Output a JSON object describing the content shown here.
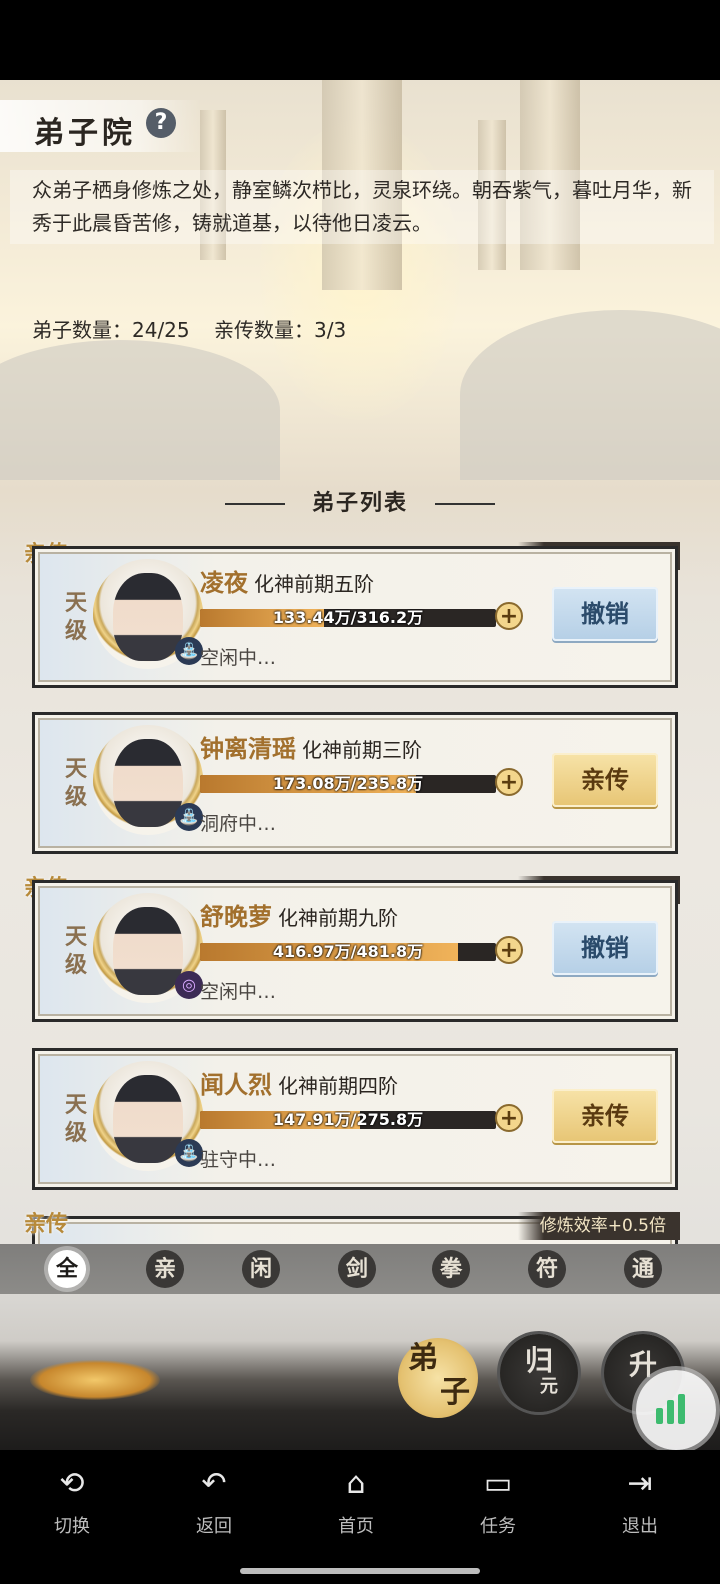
{
  "header": {
    "title": "弟子院",
    "help": "?"
  },
  "description": "众弟子栖身修炼之处，静室鳞次栉比，灵泉环绕。朝吞紫气，暮吐月华，新秀于此晨昏苦修，铸就道基，以待他日凌云。",
  "stats": {
    "disciple_count": "弟子数量：24/25",
    "inherit_count": "亲传数量：3/3"
  },
  "section_title": "弟子列表",
  "tags": {
    "inherit": "亲传",
    "efficiency": "修炼效率+0.5倍"
  },
  "disciples": [
    {
      "name": "凌夜",
      "realm": "化神前期五阶",
      "progress": "133.44万/316.2万",
      "progress_ratio": 0.42,
      "status": "空闲中…",
      "tier": "天级",
      "action": "撤销",
      "is_inherit": true
    },
    {
      "name": "钟离清瑶",
      "realm": "化神前期三阶",
      "progress": "173.08万/235.8万",
      "progress_ratio": 0.73,
      "status": "洞府中…",
      "tier": "天级",
      "action": "亲传",
      "is_inherit": false
    },
    {
      "name": "舒晚萝",
      "realm": "化神前期九阶",
      "progress": "416.97万/481.8万",
      "progress_ratio": 0.87,
      "status": "空闲中…",
      "tier": "天级",
      "action": "撤销",
      "is_inherit": true
    },
    {
      "name": "闻人烈",
      "realm": "化神前期四阶",
      "progress": "147.91万/275.8万",
      "progress_ratio": 0.54,
      "status": "驻守中…",
      "tier": "天级",
      "action": "亲传",
      "is_inherit": false
    }
  ],
  "filters": [
    "全",
    "亲",
    "闲",
    "剑",
    "拳",
    "符",
    "通"
  ],
  "big_buttons": {
    "disciple_1": "弟",
    "disciple_2": "子",
    "return_1": "归",
    "return_2": "元",
    "upgrade": "升"
  },
  "nav": [
    {
      "label": "切换",
      "icon": "switch-icon"
    },
    {
      "label": "返回",
      "icon": "back-icon"
    },
    {
      "label": "首页",
      "icon": "home-icon"
    },
    {
      "label": "任务",
      "icon": "task-icon"
    },
    {
      "label": "退出",
      "icon": "exit-icon"
    }
  ],
  "colors": {
    "accent_gold": "#e4c170",
    "name_gold": "#a2702d",
    "revoke_blue": "#b5cfe6",
    "bar_fill": "#f0b35a"
  }
}
